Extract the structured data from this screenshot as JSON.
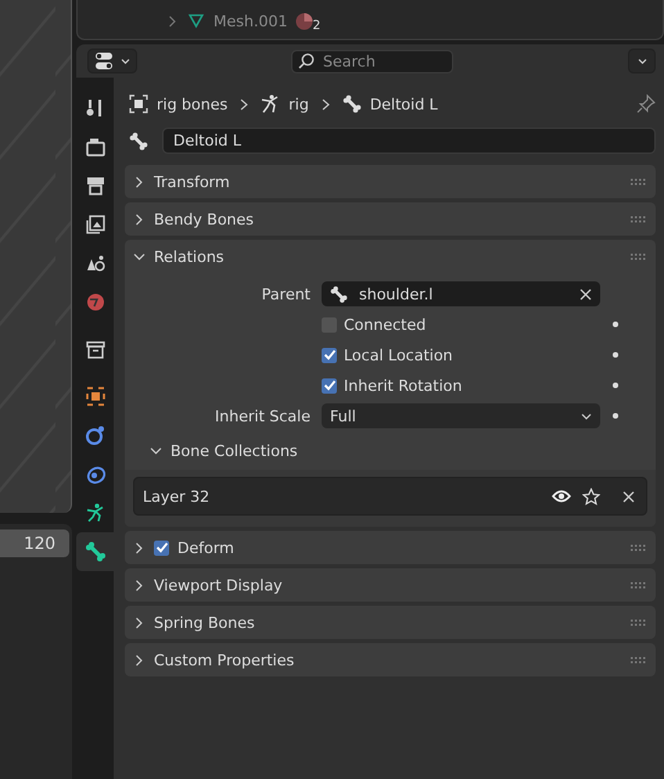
{
  "outliner": {
    "row": {
      "label": "Mesh.001",
      "badge": "2",
      "expanded": false
    }
  },
  "timeline": {
    "frame": "120"
  },
  "header": {
    "search_placeholder": "Search"
  },
  "tabs": [
    {
      "kind": "tool",
      "selected": false
    },
    {
      "kind": "render",
      "selected": false
    },
    {
      "kind": "output",
      "selected": false
    },
    {
      "kind": "view",
      "selected": false
    },
    {
      "kind": "scene",
      "selected": false
    },
    {
      "kind": "world",
      "selected": false
    },
    {
      "kind": "collection",
      "selected": false
    },
    {
      "kind": "object",
      "selected": false
    },
    {
      "kind": "physics",
      "selected": false
    },
    {
      "kind": "constraint",
      "selected": false
    },
    {
      "kind": "armature",
      "selected": false
    },
    {
      "kind": "bone",
      "selected": true
    }
  ],
  "breadcrumb": [
    {
      "kind": "object",
      "label": "rig bones"
    },
    {
      "kind": "armature",
      "label": "rig"
    },
    {
      "kind": "bone",
      "label": "Deltoid L"
    }
  ],
  "bone_name": "Deltoid L",
  "panels": [
    {
      "title": "Transform",
      "expanded": false
    },
    {
      "title": "Bendy Bones",
      "expanded": false
    },
    {
      "title": "Relations",
      "expanded": true,
      "kind": "relations"
    },
    {
      "title": "Deform",
      "expanded": false,
      "checkbox": {
        "checked": true
      }
    },
    {
      "title": "Viewport Display",
      "expanded": false
    },
    {
      "title": "Spring Bones",
      "expanded": false
    },
    {
      "title": "Custom Properties",
      "expanded": false
    }
  ],
  "relations": {
    "parent_label": "Parent",
    "parent": "shoulder.l",
    "checks": [
      {
        "label": "Connected",
        "checked": false
      },
      {
        "label": "Local Location",
        "checked": true
      },
      {
        "label": "Inherit Rotation",
        "checked": true
      }
    ],
    "inherit_scale_label": "Inherit Scale",
    "inherit_scale": "Full",
    "bone_collections": {
      "title": "Bone Collections",
      "expanded": true,
      "items": [
        {
          "name": "Layer 32"
        }
      ]
    }
  }
}
